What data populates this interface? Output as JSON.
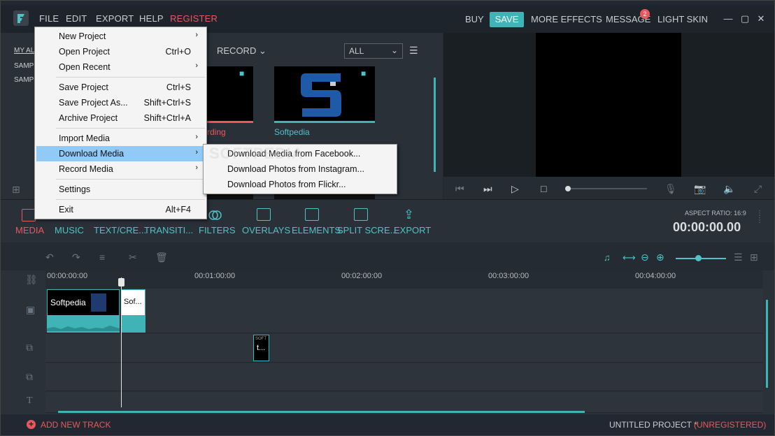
{
  "menubar": {
    "file": "FILE",
    "edit": "EDIT",
    "export": "EXPORT",
    "help": "HELP",
    "register": "REGISTER"
  },
  "topright": {
    "buy": "BUY",
    "save": "SAVE",
    "more_effects": "MORE EFFECTS",
    "message": "MESSAGE",
    "message_count": "2",
    "light_skin": "LIGHT SKIN"
  },
  "library": {
    "side_items": [
      "MY AL",
      "SAMP",
      "SAMP"
    ],
    "record_label": "RECORD",
    "filter_value": "ALL",
    "items": [
      {
        "label": "rding"
      },
      {
        "label": "Softpedia"
      }
    ]
  },
  "file_menu": {
    "items": [
      {
        "label": "New Project",
        "shortcut": "",
        "submenu": true
      },
      {
        "label": "Open Project",
        "shortcut": "Ctrl+O",
        "submenu": false
      },
      {
        "label": "Open Recent",
        "shortcut": "",
        "submenu": true
      },
      {
        "label": "Save Project",
        "shortcut": "Ctrl+S",
        "submenu": false
      },
      {
        "label": "Save Project As...",
        "shortcut": "Shift+Ctrl+S",
        "submenu": false
      },
      {
        "label": "Archive Project",
        "shortcut": "Shift+Ctrl+A",
        "submenu": false
      },
      {
        "label": "Import Media",
        "shortcut": "",
        "submenu": true
      },
      {
        "label": "Download Media",
        "shortcut": "",
        "submenu": true
      },
      {
        "label": "Record Media",
        "shortcut": "",
        "submenu": true
      },
      {
        "label": "Settings",
        "shortcut": "",
        "submenu": false
      },
      {
        "label": "Exit",
        "shortcut": "Alt+F4",
        "submenu": false
      }
    ],
    "highlighted": "Download Media"
  },
  "download_submenu": {
    "items": [
      "Download Media from Facebook...",
      "Download Photos from Instagram...",
      "Download Photos from Flickr..."
    ]
  },
  "tools": {
    "media": "MEDIA",
    "music": "MUSIC",
    "text": "TEXT/CRE...",
    "transitions": "TRANSITI...",
    "filters": "FILTERS",
    "overlays": "OVERLAYS",
    "elements": "ELEMENTS",
    "split_screen": "SPLIT SCRE...",
    "export": "EXPORT"
  },
  "preview": {
    "aspect_ratio": "ASPECT RATIO: 16:9",
    "timecode": "00:00:00.00"
  },
  "timeline": {
    "ruler": [
      "00:00:00:00",
      "00:01:00:00",
      "00:02:00:00",
      "00:03:00:00",
      "00:04:00:00"
    ],
    "clip1_label": "Softpedia",
    "clip2_label": "Sof...",
    "overlay_clip_label": "t...",
    "overlay_clip_small": "SOFT"
  },
  "status": {
    "add_track": "ADD NEW TRACK",
    "project": "UNTITLED PROJECT *",
    "unregistered": "(UNREGISTERED)"
  },
  "colors": {
    "accent": "#3fb3b5",
    "red": "#e8585d"
  },
  "watermark": "SOFTPEDIA"
}
